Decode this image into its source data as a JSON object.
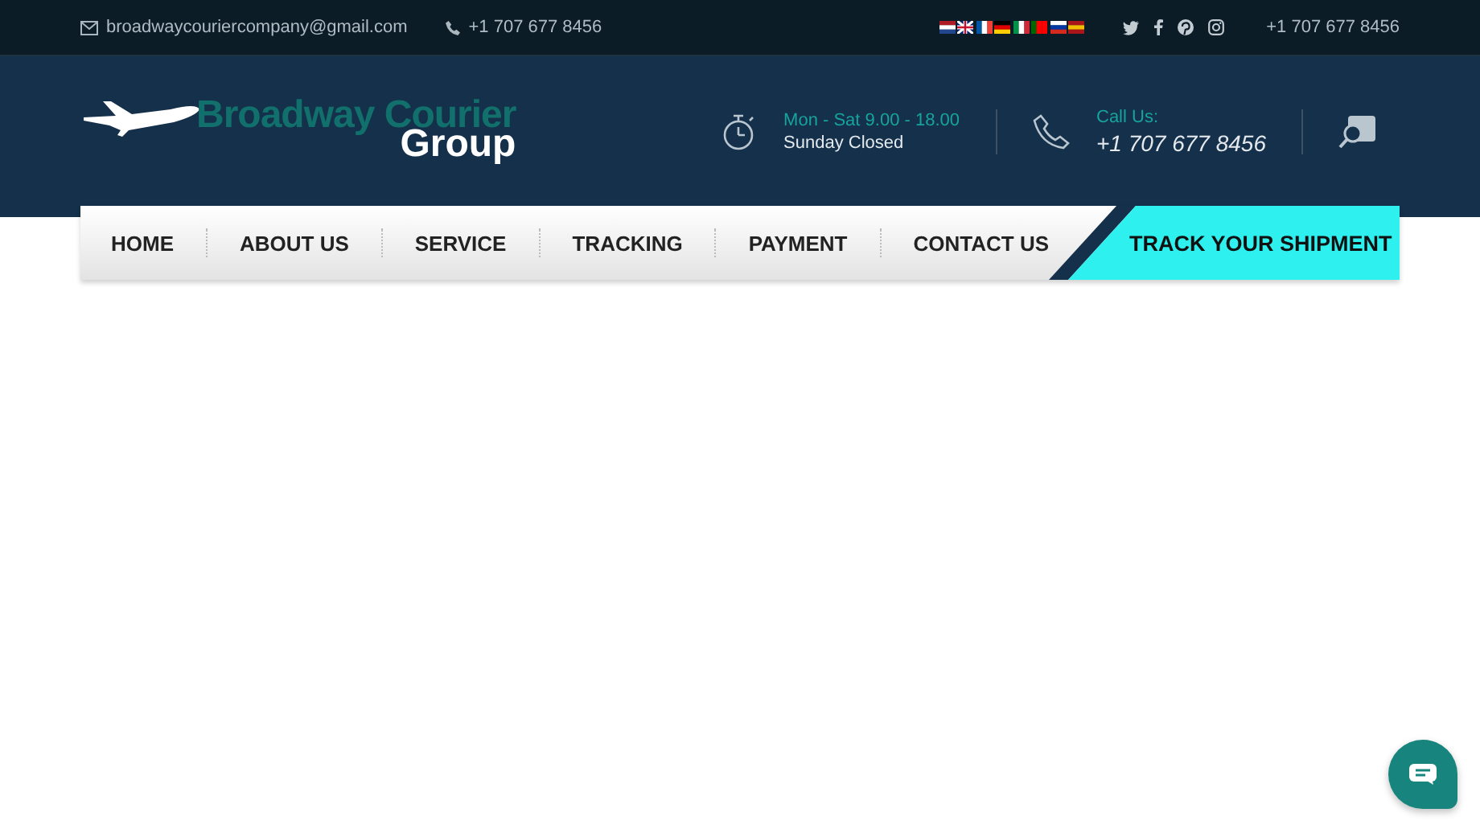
{
  "top_bar": {
    "email": "broadwaycouriercompany@gmail.com",
    "phone": "+1 707 677 8456",
    "languages": [
      {
        "kind": "nl"
      },
      {
        "kind": "uk"
      },
      {
        "kind": "fr"
      },
      {
        "kind": "de"
      },
      {
        "kind": "it"
      },
      {
        "kind": "pt"
      },
      {
        "kind": "ru"
      },
      {
        "kind": "es"
      }
    ],
    "social": [
      {
        "kind": "twitter"
      },
      {
        "kind": "facebook"
      },
      {
        "kind": "pinterest"
      },
      {
        "kind": "instagram"
      }
    ],
    "phone_right": "+1 707 677 8456"
  },
  "header": {
    "logo": {
      "line_1": "Broadway Courier",
      "line_2": "Group"
    },
    "hours": {
      "label": "Mon - Sat 9.00 - 18.00",
      "value": "Sunday Closed"
    },
    "call": {
      "label": "Call Us:",
      "value": "+1 707 677 8456"
    }
  },
  "nav": {
    "items": [
      {
        "label": "HOME"
      },
      {
        "label": "ABOUT US"
      },
      {
        "label": "SERVICE"
      },
      {
        "label": "TRACKING"
      },
      {
        "label": "PAYMENT"
      },
      {
        "label": "CONTACT US"
      }
    ],
    "cta": "TRACK YOUR SHIPMENT"
  }
}
